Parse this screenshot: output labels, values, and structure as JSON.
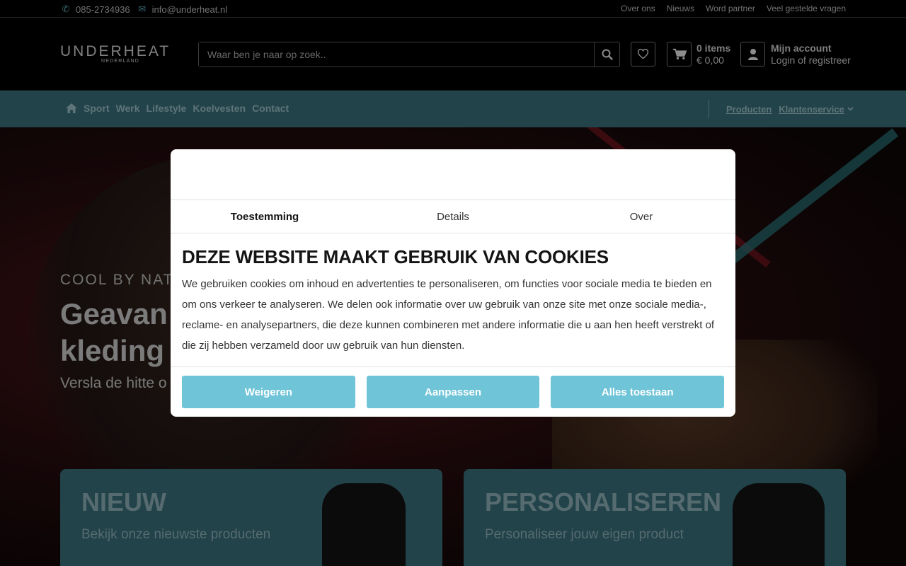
{
  "topbar": {
    "phone": "085-2734936",
    "email": "info@underheat.nl",
    "links": [
      "Over ons",
      "Nieuws",
      "Word partner",
      "Veel gestelde vragen"
    ]
  },
  "header": {
    "logo_main": "UNDERHEAT",
    "logo_sub": "NEDERLAND",
    "search_placeholder": "Waar ben je naar op zoek..",
    "cart_items": "0 items",
    "cart_total": "€ 0,00",
    "account_title": "Mijn account",
    "account_sub": "Login of registreer"
  },
  "nav": {
    "items": [
      "Sport",
      "Werk",
      "Lifestyle",
      "Koelvesten",
      "Contact"
    ],
    "right": [
      "Producten",
      "Klantenservice"
    ]
  },
  "hero": {
    "tagline": "COOL BY NATU",
    "title_line1": "Geavan",
    "title_line2": "kleding",
    "subtitle": "Versla de hitte o"
  },
  "cards": [
    {
      "title": "NIEUW",
      "desc": "Bekijk onze nieuwste producten"
    },
    {
      "title": "PERSONALISEREN",
      "desc": "Personaliseer jouw eigen product"
    }
  ],
  "cookie": {
    "tabs": [
      "Toestemming",
      "Details",
      "Over"
    ],
    "heading": "DEZE WEBSITE MAAKT GEBRUIK VAN COOKIES",
    "text": "We gebruiken cookies om inhoud en advertenties te personaliseren, om functies voor sociale media te bieden en om ons verkeer te analyseren. We delen ook informatie over uw gebruik van onze site met onze sociale media-, reclame- en analysepartners, die deze kunnen combineren met andere informatie die u aan hen heeft verstrekt of die zij hebben verzameld door uw gebruik van hun diensten.",
    "buttons": [
      "Weigeren",
      "Aanpassen",
      "Alles toestaan"
    ]
  },
  "colors": {
    "accent": "#6fc4d7",
    "nav_bg": "#3f7a86"
  }
}
